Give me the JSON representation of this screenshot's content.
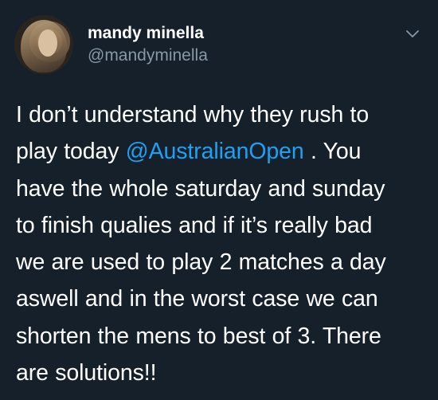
{
  "tweet": {
    "author_name": "mandy minella",
    "author_handle": "@mandyminella",
    "menu_icon": "chevron-down-icon",
    "lines": [
      "I don’t understand why they rush to",
      {
        "before": "play today ",
        "mention": "@AustralianOpen",
        "after": " . You"
      },
      "have the whole saturday and sunday",
      "to finish qualies and if it’s really bad",
      "we are used to play 2 matches a day",
      "aswell and in the worst case we can",
      "shorten the mens to best of 3. There",
      "are solutions!!"
    ]
  },
  "colors": {
    "background": "#15202b",
    "text": "#ffffff",
    "secondary": "#8899a6",
    "link": "#1da1f2"
  }
}
